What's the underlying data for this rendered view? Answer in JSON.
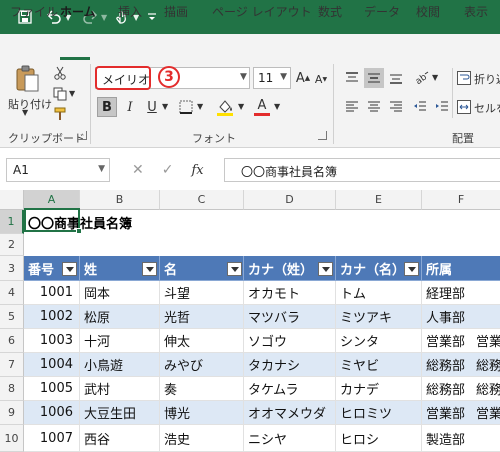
{
  "quick_access": {
    "save_icon": "save-icon",
    "undo_icon": "undo-icon",
    "redo_icon": "redo-icon",
    "touch_icon": "touch-mode-icon",
    "customize_icon": "customize-qat-icon"
  },
  "tabs": [
    {
      "label": "ファイル",
      "active": false
    },
    {
      "label": "ホーム",
      "active": true
    },
    {
      "label": "挿入",
      "active": false
    },
    {
      "label": "描画",
      "active": false
    },
    {
      "label": "ページ レイアウト",
      "active": false
    },
    {
      "label": "数式",
      "active": false
    },
    {
      "label": "データ",
      "active": false
    },
    {
      "label": "校閲",
      "active": false
    },
    {
      "label": "表示",
      "active": false
    }
  ],
  "ribbon": {
    "clipboard": {
      "paste_label": "貼り付け",
      "group_label": "クリップボード"
    },
    "font": {
      "font_name": "メイリオ",
      "font_size": "11",
      "bold_label": "B",
      "italic_label": "I",
      "underline_label": "U",
      "font_color_label": "A",
      "group_label": "フォント",
      "callout": "3"
    },
    "alignment": {
      "wrap_label": "折り返",
      "merge_label": "セルを",
      "group_label": "配置"
    }
  },
  "formula_bar": {
    "name_box": "A1",
    "fx_label": "fx",
    "content": "〇〇商事社員名簿"
  },
  "sheet": {
    "columns": [
      "A",
      "B",
      "C",
      "D",
      "E",
      "F"
    ],
    "rows": [
      "1",
      "2",
      "3",
      "4",
      "5",
      "6",
      "7",
      "8",
      "9",
      "10"
    ],
    "title": "〇〇商事社員名簿",
    "headers": [
      "番号",
      "姓",
      "名",
      "カナ（姓）",
      "カナ（名）",
      "所属"
    ],
    "records": [
      {
        "no": "1001",
        "sei": "岡本",
        "mei": "斗望",
        "kana_sei": "オカモト",
        "kana_mei": "トム",
        "dept": "経理部",
        "extra": ""
      },
      {
        "no": "1002",
        "sei": "松原",
        "mei": "光哲",
        "kana_sei": "マツバラ",
        "kana_mei": "ミツアキ",
        "dept": "人事部",
        "extra": ""
      },
      {
        "no": "1003",
        "sei": "十河",
        "mei": "伸太",
        "kana_sei": "ソゴウ",
        "kana_mei": "シンタ",
        "dept": "営業部",
        "extra": "営業"
      },
      {
        "no": "1004",
        "sei": "小鳥遊",
        "mei": "みやび",
        "kana_sei": "タカナシ",
        "kana_mei": "ミヤビ",
        "dept": "総務部",
        "extra": "総務"
      },
      {
        "no": "1005",
        "sei": "武村",
        "mei": "奏",
        "kana_sei": "タケムラ",
        "kana_mei": "カナデ",
        "dept": "総務部",
        "extra": "総務"
      },
      {
        "no": "1006",
        "sei": "大豆生田",
        "mei": "博光",
        "kana_sei": "オオマメウダ",
        "kana_mei": "ヒロミツ",
        "dept": "営業部",
        "extra": "営業"
      },
      {
        "no": "1007",
        "sei": "西谷",
        "mei": "浩史",
        "kana_sei": "ニシヤ",
        "kana_mei": "ヒロシ",
        "dept": "製造部",
        "extra": ""
      }
    ]
  },
  "colors": {
    "accent": "#217346",
    "table_header": "#4e79b7",
    "band": "#dde8f5",
    "callout": "#e32c2c"
  }
}
